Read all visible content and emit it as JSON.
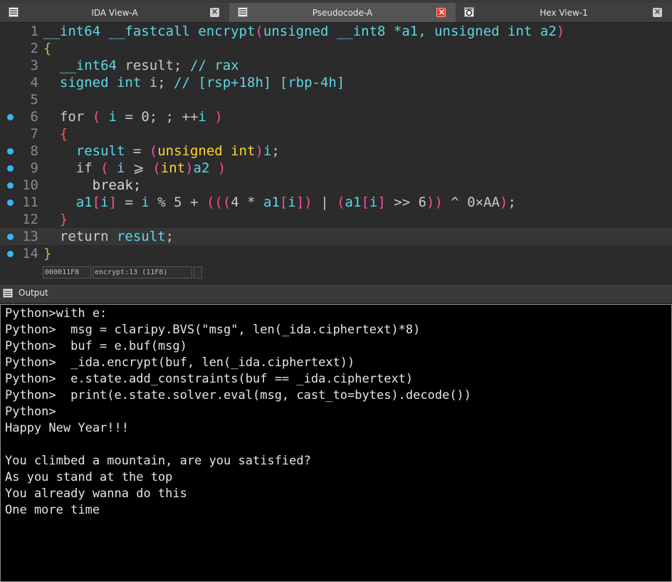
{
  "tabs": [
    {
      "label": "IDA View-A",
      "icon": "disassembly-view-icon",
      "active": false
    },
    {
      "label": "Pseudocode-A",
      "icon": "pseudocode-view-icon",
      "active": true
    },
    {
      "label": "Hex View-1",
      "icon": "hex-view-icon",
      "active": false
    }
  ],
  "code": {
    "line_numbers": [
      "1",
      "2",
      "3",
      "4",
      "5",
      "6",
      "7",
      "8",
      "9",
      "10",
      "11",
      "12",
      "13",
      "14"
    ],
    "breakpoint_lines": [
      "6",
      "8",
      "9",
      "10",
      "11",
      "13",
      "14"
    ],
    "current_line": "13"
  },
  "status": {
    "address": "000011F8",
    "location": "encrypt:13 (11F8)"
  },
  "output": {
    "title": "Output",
    "lines": [
      "Python>with e:",
      "Python>  msg = claripy.BVS(\"msg\", len(_ida.ciphertext)*8)",
      "Python>  buf = e.buf(msg)",
      "Python>  _ida.encrypt(buf, len(_ida.ciphertext))",
      "Python>  e.state.add_constraints(buf == _ida.ciphertext)",
      "Python>  print(e.state.solver.eval(msg, cast_to=bytes).decode())",
      "Python>",
      "Happy New Year!!!",
      "",
      "You climbed a mountain, are you satisfied?",
      "As you stand at the top",
      "You already wanna do this",
      "One more time"
    ]
  },
  "colors": {
    "type": "#5fd6e8",
    "paren": "#ff4d99",
    "cast_type": "#ffd633",
    "brace": "#8cd84a",
    "inner_brace": "#ff5555",
    "breakpoint": "#35b7f5"
  }
}
